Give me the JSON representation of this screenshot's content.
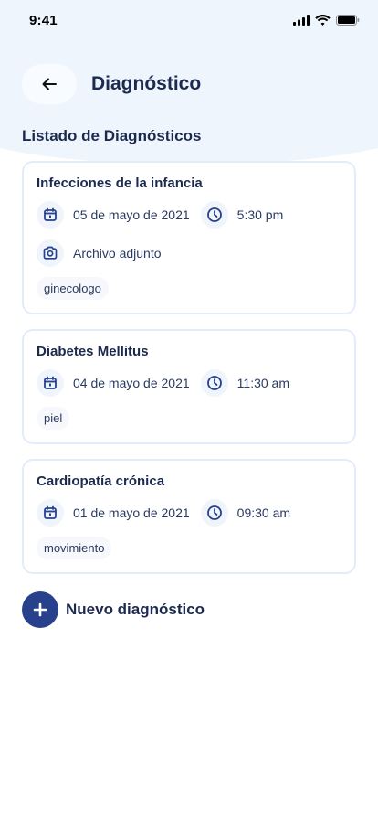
{
  "status_bar": {
    "time": "9:41"
  },
  "header": {
    "title": "Diagnóstico"
  },
  "section_title": "Listado de Diagnósticos",
  "diagnoses": [
    {
      "title": "Infecciones de la infancia",
      "date": "05 de mayo de 2021",
      "time": "5:30 pm",
      "attachment": "Archivo adjunto",
      "tag": "ginecologo"
    },
    {
      "title": "Diabetes Mellitus",
      "date": "04 de mayo de 2021",
      "time": "11:30 am",
      "tag": "piel"
    },
    {
      "title": "Cardiopatía crónica",
      "date": "01 de mayo de 2021",
      "time": "09:30 am",
      "tag": "movimiento"
    }
  ],
  "new_button": {
    "label": "Nuevo diagnóstico"
  },
  "colors": {
    "accent": "#27418d",
    "text": "#1c2a4f",
    "header_bg": "#eef5fd",
    "card_border": "#e3edfa"
  },
  "icons": [
    "arrow-left-icon",
    "calendar-icon",
    "clock-icon",
    "camera-icon",
    "plus-icon"
  ]
}
